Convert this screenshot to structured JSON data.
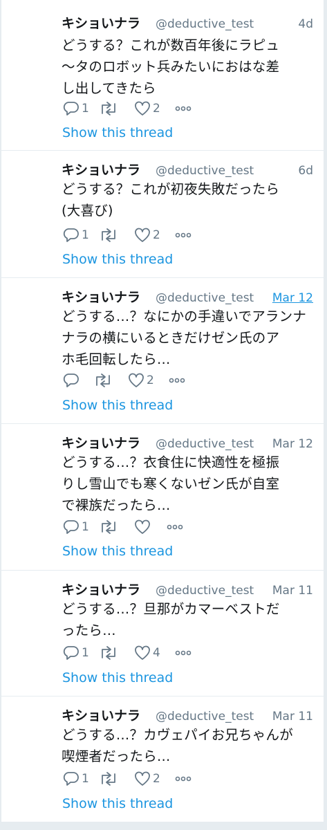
{
  "tweets": [
    {
      "display_name": "キショいナラ",
      "handle": "@deductive_test",
      "time": "4d",
      "lines": [
        "どうする？これが数百年後にラピュ",
        "〜タのロボット兵みたいにおはな差",
        "し出してきたら"
      ],
      "reply_count": "1",
      "retweet_count": "",
      "like_count": "2",
      "show_thread": "Show this thread"
    },
    {
      "display_name": "キショいナラ",
      "handle": "@deductive_test",
      "time": "6d",
      "lines": [
        "どうする？これが初夜失敗だったら",
        "(大喜び)"
      ],
      "reply_count": "1",
      "retweet_count": "",
      "like_count": "2",
      "show_thread": "Show this thread"
    },
    {
      "display_name": "キショいナラ",
      "handle": "@deductive_test",
      "time": "Mar 12",
      "lines": [
        "どうする…？なにかの手違いでアランナ",
        "ナラの横にいるときだけゼン氏のア",
        "ホ毛回転したら…"
      ],
      "reply_count": "",
      "retweet_count": "",
      "like_count": "2",
      "show_thread": "Show this thread"
    },
    {
      "display_name": "キショいナラ",
      "handle": "@deductive_test",
      "time": "Mar 12",
      "lines": [
        "どうする…？衣食住に快適性を極振",
        "りし雪山でも寒くないゼン氏が自室",
        "で裸族だったら…"
      ],
      "reply_count": "1",
      "retweet_count": "",
      "like_count": "",
      "show_thread": "Show this thread"
    },
    {
      "display_name": "キショいナラ",
      "handle": "@deductive_test",
      "time": "Mar 11",
      "lines": [
        "どうする…？旦那がカマーベストだ",
        "ったら…"
      ],
      "reply_count": "1",
      "retweet_count": "",
      "like_count": "4",
      "show_thread": "Show this thread"
    },
    {
      "display_name": "キショいナラ",
      "handle": "@deductive_test",
      "time": "Mar 11",
      "lines": [
        "どうする…？カヴェパイお兄ちゃんが",
        "喫煙者だったら…"
      ],
      "reply_count": "1",
      "retweet_count": "",
      "like_count": "2",
      "show_thread": "Show this thread"
    }
  ],
  "icons": {
    "reply": "reply-icon",
    "retweet": "retweet-icon",
    "like": "heart-icon",
    "more": "more-icon"
  },
  "colors": {
    "text": "#14171a",
    "secondary": "#657786",
    "link": "#1b95e0",
    "border": "#e6ecf0"
  }
}
